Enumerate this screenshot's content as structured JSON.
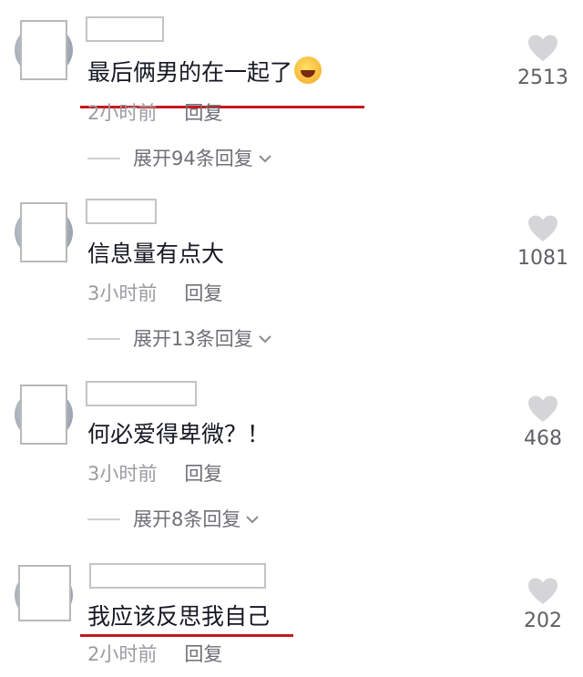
{
  "comments": [
    {
      "text": "最后俩男的在一起了",
      "emoji": "rofl-emoji",
      "time": "2小时前",
      "reply_label": "回复",
      "expand_label": "展开94条回复",
      "likes": "2513",
      "underlined": true
    },
    {
      "text": "信息量有点大",
      "time": "3小时前",
      "reply_label": "回复",
      "expand_label": "展开13条回复",
      "likes": "1081",
      "underlined": false
    },
    {
      "text": "何必爱得卑微？！",
      "time": "3小时前",
      "reply_label": "回复",
      "expand_label": "展开8条回复",
      "likes": "468",
      "underlined": false
    },
    {
      "text": "我应该反思我自己",
      "time": "2小时前",
      "reply_label": "回复",
      "likes": "202",
      "underlined": true
    }
  ],
  "colors": {
    "underline": "#c4191f",
    "heart": "#d5d5d8",
    "meta_text": "#9b9ca0"
  },
  "icons": {
    "like": "heart-icon",
    "expand": "chevron-down-icon"
  }
}
